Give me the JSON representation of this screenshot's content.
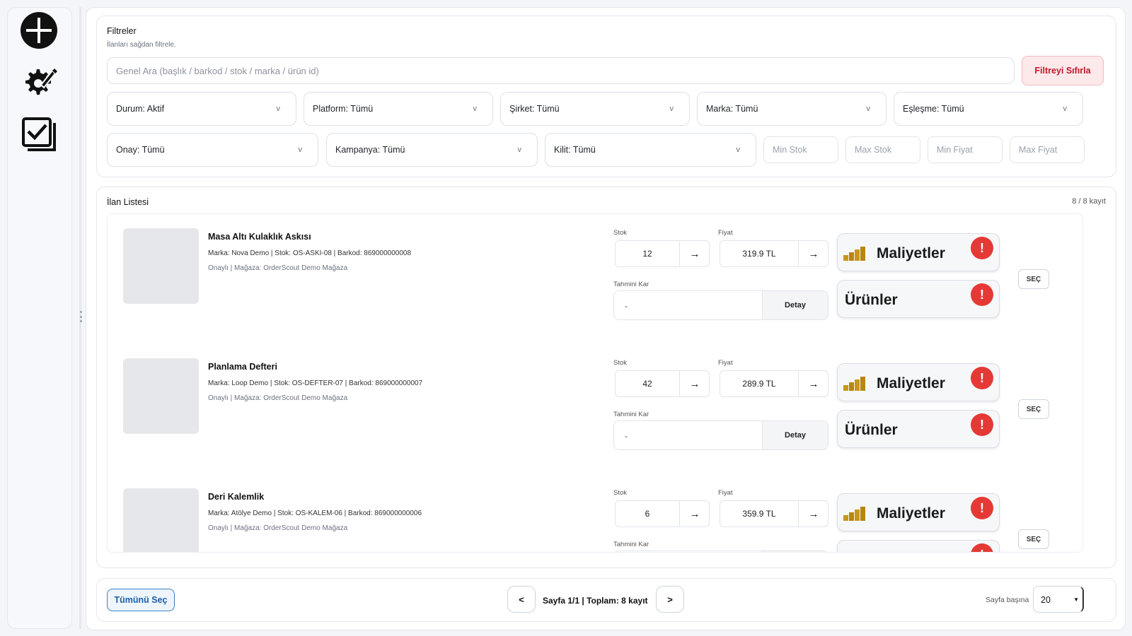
{
  "sidebar": {
    "items": [
      {
        "name": "add-icon"
      },
      {
        "name": "edit-settings-icon"
      },
      {
        "name": "checklist-icon"
      }
    ]
  },
  "filters": {
    "title": "Filtreler",
    "subtitle": "İlanları sağdan filtrele.",
    "search_placeholder": "Genel Ara (başlık / barkod / stok / marka / ürün id)",
    "reset_label": "Filtreyi Sıfırla",
    "selects_row1": [
      "Durum: Aktif",
      "Platform: Tümü",
      "Şirket: Tümü",
      "Marka: Tümü",
      "Eşleşme: Tümü"
    ],
    "selects_row2": [
      "Onay: Tümü",
      "Kampanya: Tümü",
      "Kilit: Tümü"
    ],
    "chevron": "v",
    "min_stok": "Min Stok",
    "max_stok": "Max Stok",
    "min_fiyat": "Min Fiyat",
    "max_fiyat": "Max Fiyat"
  },
  "listing": {
    "title": "İlan Listesi",
    "count": "8 / 8 kayıt",
    "labels": {
      "stok": "Stok",
      "fiyat": "Fiyat",
      "tahmini_kar": "Tahmini Kar",
      "detay": "Detay",
      "maliyetler": "Maliyetler",
      "urunler": "Ürünler",
      "sec": "SEÇ",
      "arrow": "→",
      "alert": "!"
    },
    "items": [
      {
        "name": "Masa Altı Kulaklık Askısı",
        "meta": "Marka: Nova Demo | Stok: OS-ASKI-08 | Barkod: 869000000008",
        "store": "Onaylı | Mağaza: OrderScout Demo Mağaza",
        "stok": "12",
        "fiyat": "319.9 TL",
        "kar": "-"
      },
      {
        "name": "Planlama Defteri",
        "meta": "Marka: Loop Demo | Stok: OS-DEFTER-07 | Barkod: 869000000007",
        "store": "Onaylı | Mağaza: OrderScout Demo Mağaza",
        "stok": "42",
        "fiyat": "289.9 TL",
        "kar": "-"
      },
      {
        "name": "Deri Kalemlik",
        "meta": "Marka: Atölye Demo | Stok: OS-KALEM-06 | Barkod: 869000000006",
        "store": "Onaylı | Mağaza: OrderScout Demo Mağaza",
        "stok": "6",
        "fiyat": "359.9 TL",
        "kar": "-"
      }
    ]
  },
  "footer": {
    "select_all": "Tümünü Seç",
    "prev": "<",
    "next": ">",
    "page_info": "Sayfa 1/1 | Toplam: 8 kayıt",
    "per_page_label": "Sayfa başına",
    "per_page_value": "20"
  },
  "colors": {
    "accent_blue": "#1d5fa3",
    "danger": "#c0182b",
    "alert_red": "#e53935",
    "coin_gold": "#c8961e"
  }
}
